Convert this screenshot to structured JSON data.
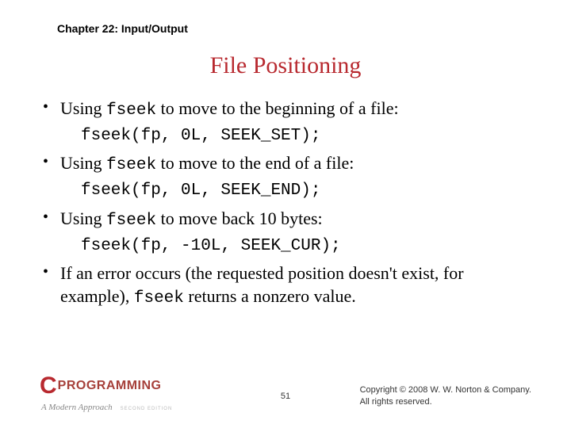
{
  "chapter": "Chapter 22: Input/Output",
  "title": "File Positioning",
  "bullets": [
    {
      "pre": "Using ",
      "code": "fseek",
      "post": " to move to the beginning of a file:"
    },
    {
      "pre": "Using ",
      "code": "fseek",
      "post": " to move to the end of a file:"
    },
    {
      "pre": "Using ",
      "code": "fseek",
      "post": " to move back 10 bytes:"
    }
  ],
  "codes": [
    "fseek(fp, 0L, SEEK_SET);",
    "fseek(fp, 0L, SEEK_END);",
    "fseek(fp, -10L, SEEK_CUR);"
  ],
  "last_bullet": {
    "pre": "If an error occurs (the requested position doesn't exist, for example), ",
    "code": "fseek",
    "post": " returns a nonzero value."
  },
  "logo": {
    "c": "C",
    "prog": "PROGRAMMING",
    "sub": "A Modern Approach",
    "ed": "SECOND EDITION"
  },
  "pagenum": "51",
  "copyright_l1": "Copyright © 2008 W. W. Norton & Company.",
  "copyright_l2": "All rights reserved."
}
